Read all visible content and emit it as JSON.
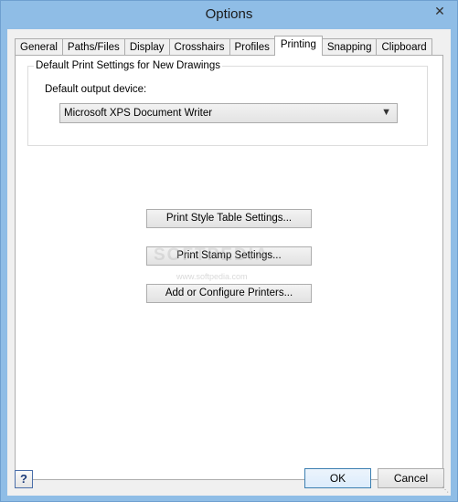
{
  "window": {
    "title": "Options",
    "close_glyph": "✕"
  },
  "tabs": [
    {
      "label": "General"
    },
    {
      "label": "Paths/Files"
    },
    {
      "label": "Display"
    },
    {
      "label": "Crosshairs"
    },
    {
      "label": "Profiles"
    },
    {
      "label": "Printing"
    },
    {
      "label": "Snapping"
    },
    {
      "label": "Clipboard"
    }
  ],
  "active_tab": "Printing",
  "printing": {
    "group_title": "Default Print Settings for New Drawings",
    "output_device_label": "Default output device:",
    "output_device_value": "Microsoft XPS Document Writer",
    "buttons": {
      "print_style_table": "Print Style Table Settings...",
      "print_stamp": "Print Stamp Settings...",
      "add_printers": "Add or Configure Printers..."
    }
  },
  "watermark": {
    "text": "SOFTPEDIA",
    "url": "www.softpedia.com"
  },
  "footer": {
    "help_label": "?",
    "ok_label": "OK",
    "cancel_label": "Cancel"
  },
  "colors": {
    "frame": "#8fbde6",
    "ok_border": "#3c7fb1"
  }
}
